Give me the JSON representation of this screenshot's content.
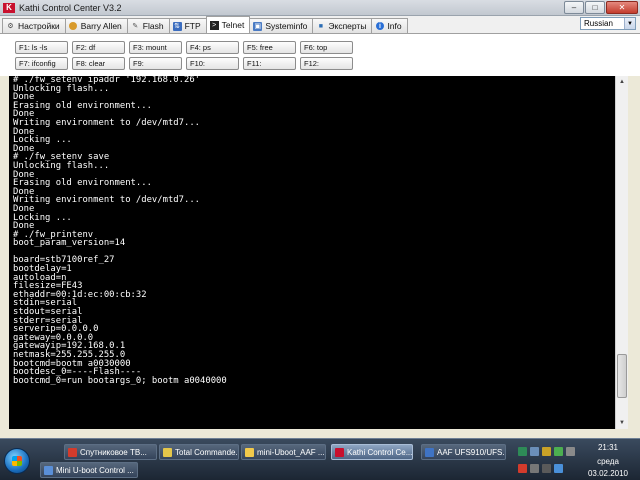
{
  "window": {
    "title": "Kathi Control Center V3.2",
    "logo_text": "K"
  },
  "tabs": [
    {
      "label": "Настройки",
      "icon": "settings-icon"
    },
    {
      "label": "Barry Allen",
      "icon": "user-icon"
    },
    {
      "label": "Flash",
      "icon": "flash-icon"
    },
    {
      "label": "FTP",
      "icon": "ftp-icon"
    },
    {
      "label": "Telnet",
      "icon": "telnet-icon"
    },
    {
      "label": "Systeminfo",
      "icon": "systeminfo-icon"
    },
    {
      "label": "Эксперты",
      "icon": "experts-icon"
    },
    {
      "label": "Info",
      "icon": "info-icon"
    }
  ],
  "active_tab": "Telnet",
  "language": {
    "selected": "Russian"
  },
  "fkeys": {
    "f1": "F1: ls -ls",
    "f2": "F2: df",
    "f3": "F3: mount",
    "f4": "F4: ps",
    "f5": "F5: free",
    "f6": "F6: top",
    "f7": "F7: ifconfig",
    "f8": "F8: clear",
    "f9": "F9:",
    "f10": "F10:",
    "f11": "F11:",
    "f12": "F12:"
  },
  "terminal": {
    "lines": [
      "# ./fw_setenv ipaddr '192.168.0.26'",
      "Unlocking flash...",
      "Done",
      "Erasing old environment...",
      "Done",
      "Writing environment to /dev/mtd7...",
      "Done",
      "Locking ...",
      "Done",
      "# ./fw_setenv save",
      "Unlocking flash...",
      "Done",
      "Erasing old environment...",
      "Done",
      "Writing environment to /dev/mtd7...",
      "Done",
      "Locking ...",
      "Done",
      "# ./fw_printenv",
      "boot_param_version=14",
      "",
      "board=stb7100ref_27",
      "bootdelay=1",
      "autoload=n",
      "filesize=FE43",
      "ethaddr=00:1d:ec:00:cb:32",
      "stdin=serial",
      "stdout=serial",
      "stderr=serial",
      "serverip=0.0.0.0",
      "gateway=0.0.0.0",
      "gatewayip=192.168.0.1",
      "netmask=255.255.255.0",
      "bootcmd=bootm a0030000",
      "bootdesc_0=----Flash----",
      "bootcmd_0=run bootargs_0; bootm a0040000"
    ]
  },
  "taskbar": {
    "tasks_row1": [
      {
        "label": "Спутниковое ТВ...",
        "color": "#d33b2c"
      },
      {
        "label": "Total Commande...",
        "color": "#e4c64a"
      },
      {
        "label": "mini-Uboot_AAF ...",
        "color": "#f1c94b"
      },
      {
        "label": "Kathi Control Ce...",
        "color": "#c8102e"
      },
      {
        "label": "AAF UFS910/UFS...",
        "color": "#3f73c4"
      }
    ],
    "tasks_row2": [
      {
        "label": "Mini U-boot Control ...",
        "color": "#5a8fd8"
      }
    ],
    "clock": {
      "time": "21:31",
      "day": "среда",
      "date": "03.02.2010"
    }
  }
}
